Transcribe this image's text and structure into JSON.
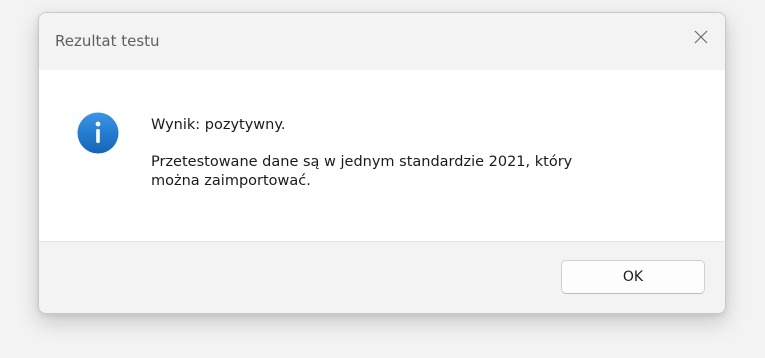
{
  "window": {
    "title": "Rezultat testu",
    "close_icon": "close-icon"
  },
  "message": {
    "icon": "info-icon",
    "result": "Wynik: pozytywny.",
    "detail_line1": "Przetestowane dane są w jednym standardzie 2021, który",
    "detail_line2": "można zaimportować."
  },
  "buttons": {
    "ok_label": "OK"
  },
  "colors": {
    "info_icon": "#1a73c9",
    "titlebar_bg": "#f3f3f3",
    "content_bg": "#ffffff"
  }
}
